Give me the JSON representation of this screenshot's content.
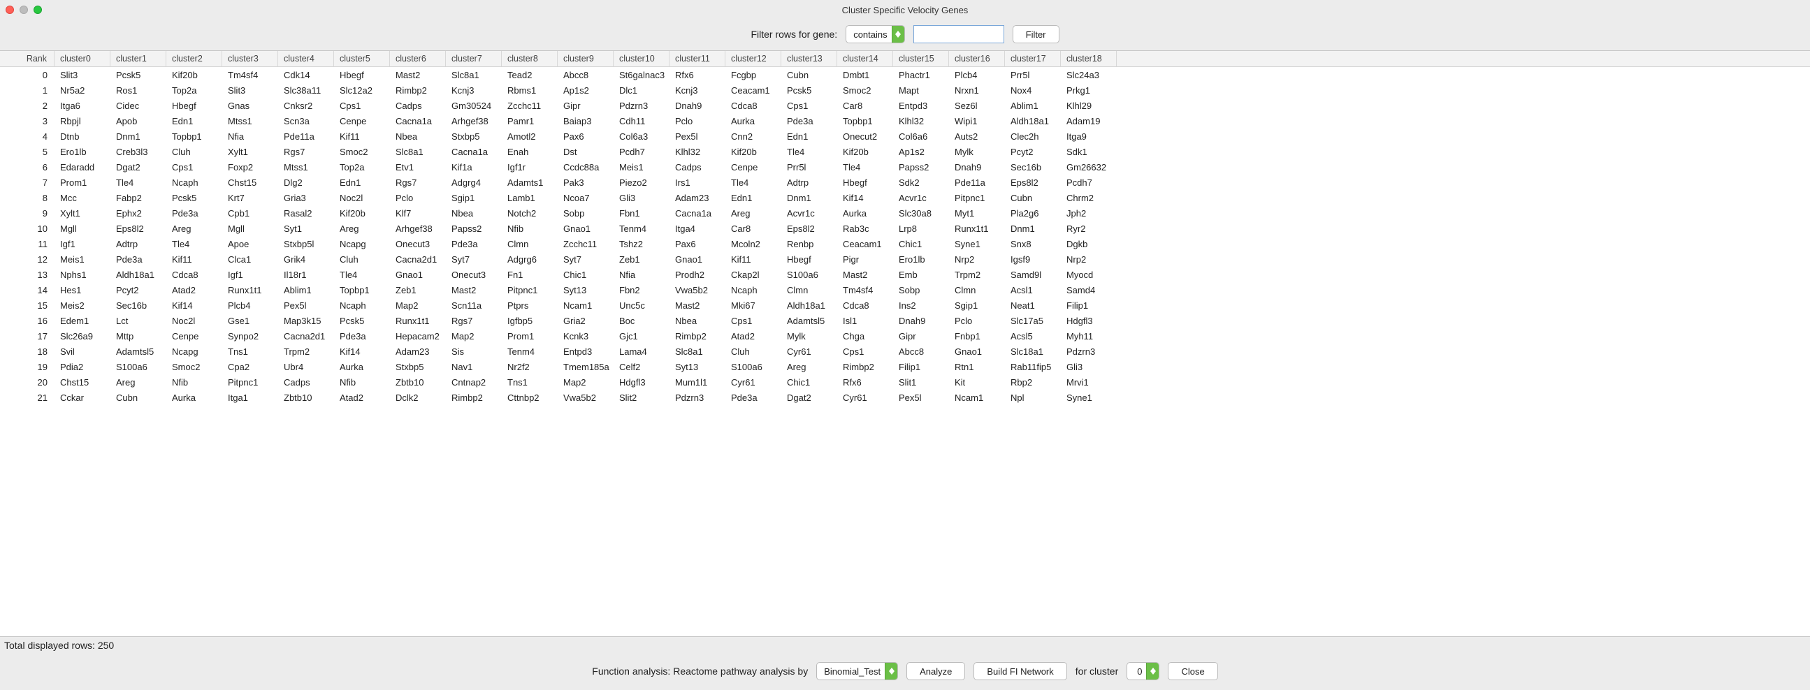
{
  "window": {
    "title": "Cluster Specific Velocity Genes"
  },
  "filter": {
    "label": "Filter rows for gene:",
    "mode": "contains",
    "value": "",
    "button": "Filter"
  },
  "columns": [
    "Rank",
    "cluster0",
    "cluster1",
    "cluster2",
    "cluster3",
    "cluster4",
    "cluster5",
    "cluster6",
    "cluster7",
    "cluster8",
    "cluster9",
    "cluster10",
    "cluster11",
    "cluster12",
    "cluster13",
    "cluster14",
    "cluster15",
    "cluster16",
    "cluster17",
    "cluster18"
  ],
  "rows": [
    {
      "rank": 0,
      "cells": [
        "Slit3",
        "Pcsk5",
        "Kif20b",
        "Tm4sf4",
        "Cdk14",
        "Hbegf",
        "Mast2",
        "Slc8a1",
        "Tead2",
        "Abcc8",
        "St6galnac3",
        "Rfx6",
        "Fcgbp",
        "Cubn",
        "Dmbt1",
        "Phactr1",
        "Plcb4",
        "Prr5l",
        "Slc24a3"
      ]
    },
    {
      "rank": 1,
      "cells": [
        "Nr5a2",
        "Ros1",
        "Top2a",
        "Slit3",
        "Slc38a11",
        "Slc12a2",
        "Rimbp2",
        "Kcnj3",
        "Rbms1",
        "Ap1s2",
        "Dlc1",
        "Kcnj3",
        "Ceacam1",
        "Pcsk5",
        "Smoc2",
        "Mapt",
        "Nrxn1",
        "Nox4",
        "Prkg1"
      ]
    },
    {
      "rank": 2,
      "cells": [
        "Itga6",
        "Cidec",
        "Hbegf",
        "Gnas",
        "Cnksr2",
        "Cps1",
        "Cadps",
        "Gm30524",
        "Zcchc11",
        "Gipr",
        "Pdzrn3",
        "Dnah9",
        "Cdca8",
        "Cps1",
        "Car8",
        "Entpd3",
        "Sez6l",
        "Ablim1",
        "Klhl29"
      ]
    },
    {
      "rank": 3,
      "cells": [
        "Rbpjl",
        "Apob",
        "Edn1",
        "Mtss1",
        "Scn3a",
        "Cenpe",
        "Cacna1a",
        "Arhgef38",
        "Pamr1",
        "Baiap3",
        "Cdh11",
        "Pclo",
        "Aurka",
        "Pde3a",
        "Topbp1",
        "Klhl32",
        "Wipi1",
        "Aldh18a1",
        "Adam19"
      ]
    },
    {
      "rank": 4,
      "cells": [
        "Dtnb",
        "Dnm1",
        "Topbp1",
        "Nfia",
        "Pde11a",
        "Kif11",
        "Nbea",
        "Stxbp5",
        "Amotl2",
        "Pax6",
        "Col6a3",
        "Pex5l",
        "Cnn2",
        "Edn1",
        "Onecut2",
        "Col6a6",
        "Auts2",
        "Clec2h",
        "Itga9"
      ]
    },
    {
      "rank": 5,
      "cells": [
        "Ero1lb",
        "Creb3l3",
        "Cluh",
        "Xylt1",
        "Rgs7",
        "Smoc2",
        "Slc8a1",
        "Cacna1a",
        "Enah",
        "Dst",
        "Pcdh7",
        "Klhl32",
        "Kif20b",
        "Tle4",
        "Kif20b",
        "Ap1s2",
        "Mylk",
        "Pcyt2",
        "Sdk1"
      ]
    },
    {
      "rank": 6,
      "cells": [
        "Edaradd",
        "Dgat2",
        "Cps1",
        "Foxp2",
        "Mtss1",
        "Top2a",
        "Etv1",
        "Kif1a",
        "Igf1r",
        "Ccdc88a",
        "Meis1",
        "Cadps",
        "Cenpe",
        "Prr5l",
        "Tle4",
        "Papss2",
        "Dnah9",
        "Sec16b",
        "Gm26632"
      ]
    },
    {
      "rank": 7,
      "cells": [
        "Prom1",
        "Tle4",
        "Ncaph",
        "Chst15",
        "Dlg2",
        "Edn1",
        "Rgs7",
        "Adgrg4",
        "Adamts1",
        "Pak3",
        "Piezo2",
        "Irs1",
        "Tle4",
        "Adtrp",
        "Hbegf",
        "Sdk2",
        "Pde11a",
        "Eps8l2",
        "Pcdh7"
      ]
    },
    {
      "rank": 8,
      "cells": [
        "Mcc",
        "Fabp2",
        "Pcsk5",
        "Krt7",
        "Gria3",
        "Noc2l",
        "Pclo",
        "Sgip1",
        "Lamb1",
        "Ncoa7",
        "Gli3",
        "Adam23",
        "Edn1",
        "Dnm1",
        "Kif14",
        "Acvr1c",
        "Pitpnc1",
        "Cubn",
        "Chrm2"
      ]
    },
    {
      "rank": 9,
      "cells": [
        "Xylt1",
        "Ephx2",
        "Pde3a",
        "Cpb1",
        "Rasal2",
        "Kif20b",
        "Klf7",
        "Nbea",
        "Notch2",
        "Sobp",
        "Fbn1",
        "Cacna1a",
        "Areg",
        "Acvr1c",
        "Aurka",
        "Slc30a8",
        "Myt1",
        "Pla2g6",
        "Jph2"
      ]
    },
    {
      "rank": 10,
      "cells": [
        "Mgll",
        "Eps8l2",
        "Areg",
        "Mgll",
        "Syt1",
        "Areg",
        "Arhgef38",
        "Papss2",
        "Nfib",
        "Gnao1",
        "Tenm4",
        "Itga4",
        "Car8",
        "Eps8l2",
        "Rab3c",
        "Lrp8",
        "Runx1t1",
        "Dnm1",
        "Ryr2"
      ]
    },
    {
      "rank": 11,
      "cells": [
        "Igf1",
        "Adtrp",
        "Tle4",
        "Apoe",
        "Stxbp5l",
        "Ncapg",
        "Onecut3",
        "Pde3a",
        "Clmn",
        "Zcchc11",
        "Tshz2",
        "Pax6",
        "Mcoln2",
        "Renbp",
        "Ceacam1",
        "Chic1",
        "Syne1",
        "Snx8",
        "Dgkb"
      ]
    },
    {
      "rank": 12,
      "cells": [
        "Meis1",
        "Pde3a",
        "Kif11",
        "Clca1",
        "Grik4",
        "Cluh",
        "Cacna2d1",
        "Syt7",
        "Adgrg6",
        "Syt7",
        "Zeb1",
        "Gnao1",
        "Kif11",
        "Hbegf",
        "Pigr",
        "Ero1lb",
        "Nrp2",
        "Igsf9",
        "Nrp2"
      ]
    },
    {
      "rank": 13,
      "cells": [
        "Nphs1",
        "Aldh18a1",
        "Cdca8",
        "Igf1",
        "Il18r1",
        "Tle4",
        "Gnao1",
        "Onecut3",
        "Fn1",
        "Chic1",
        "Nfia",
        "Prodh2",
        "Ckap2l",
        "S100a6",
        "Mast2",
        "Emb",
        "Trpm2",
        "Samd9l",
        "Myocd"
      ]
    },
    {
      "rank": 14,
      "cells": [
        "Hes1",
        "Pcyt2",
        "Atad2",
        "Runx1t1",
        "Ablim1",
        "Topbp1",
        "Zeb1",
        "Mast2",
        "Pitpnc1",
        "Syt13",
        "Fbn2",
        "Vwa5b2",
        "Ncaph",
        "Clmn",
        "Tm4sf4",
        "Sobp",
        "Clmn",
        "Acsl1",
        "Samd4"
      ]
    },
    {
      "rank": 15,
      "cells": [
        "Meis2",
        "Sec16b",
        "Kif14",
        "Plcb4",
        "Pex5l",
        "Ncaph",
        "Map2",
        "Scn11a",
        "Ptprs",
        "Ncam1",
        "Unc5c",
        "Mast2",
        "Mki67",
        "Aldh18a1",
        "Cdca8",
        "Ins2",
        "Sgip1",
        "Neat1",
        "Filip1"
      ]
    },
    {
      "rank": 16,
      "cells": [
        "Edem1",
        "Lct",
        "Noc2l",
        "Gse1",
        "Map3k15",
        "Pcsk5",
        "Runx1t1",
        "Rgs7",
        "Igfbp5",
        "Gria2",
        "Boc",
        "Nbea",
        "Cps1",
        "Adamtsl5",
        "Isl1",
        "Dnah9",
        "Pclo",
        "Slc17a5",
        "Hdgfl3"
      ]
    },
    {
      "rank": 17,
      "cells": [
        "Slc26a9",
        "Mttp",
        "Cenpe",
        "Synpo2",
        "Cacna2d1",
        "Pde3a",
        "Hepacam2",
        "Map2",
        "Prom1",
        "Kcnk3",
        "Gjc1",
        "Rimbp2",
        "Atad2",
        "Mylk",
        "Chga",
        "Gipr",
        "Fnbp1",
        "Acsl5",
        "Myh11"
      ]
    },
    {
      "rank": 18,
      "cells": [
        "Svil",
        "Adamtsl5",
        "Ncapg",
        "Tns1",
        "Trpm2",
        "Kif14",
        "Adam23",
        "Sis",
        "Tenm4",
        "Entpd3",
        "Lama4",
        "Slc8a1",
        "Cluh",
        "Cyr61",
        "Cps1",
        "Abcc8",
        "Gnao1",
        "Slc18a1",
        "Pdzrn3"
      ]
    },
    {
      "rank": 19,
      "cells": [
        "Pdia2",
        "S100a6",
        "Smoc2",
        "Cpa2",
        "Ubr4",
        "Aurka",
        "Stxbp5",
        "Nav1",
        "Nr2f2",
        "Tmem185a",
        "Celf2",
        "Syt13",
        "S100a6",
        "Areg",
        "Rimbp2",
        "Filip1",
        "Rtn1",
        "Rab11fip5",
        "Gli3"
      ]
    },
    {
      "rank": 20,
      "cells": [
        "Chst15",
        "Areg",
        "Nfib",
        "Pitpnc1",
        "Cadps",
        "Nfib",
        "Zbtb10",
        "Cntnap2",
        "Tns1",
        "Map2",
        "Hdgfl3",
        "Mum1l1",
        "Cyr61",
        "Chic1",
        "Rfx6",
        "Slit1",
        "Kit",
        "Rbp2",
        "Mrvi1"
      ]
    },
    {
      "rank": 21,
      "cells": [
        "Cckar",
        "Cubn",
        "Aurka",
        "Itga1",
        "Zbtb10",
        "Atad2",
        "Dclk2",
        "Rimbp2",
        "Cttnbp2",
        "Vwa5b2",
        "Slit2",
        "Pdzrn3",
        "Pde3a",
        "Dgat2",
        "Cyr61",
        "Pex5l",
        "Ncam1",
        "Npl",
        "Syne1"
      ]
    }
  ],
  "status": {
    "total_label": "Total displayed rows: 250"
  },
  "bottom": {
    "func_label": "Function analysis:  Reactome pathway analysis by",
    "test": "Binomial_Test",
    "analyze": "Analyze",
    "build": "Build FI Network",
    "for_cluster": "for cluster",
    "cluster_val": "0",
    "close": "Close"
  }
}
